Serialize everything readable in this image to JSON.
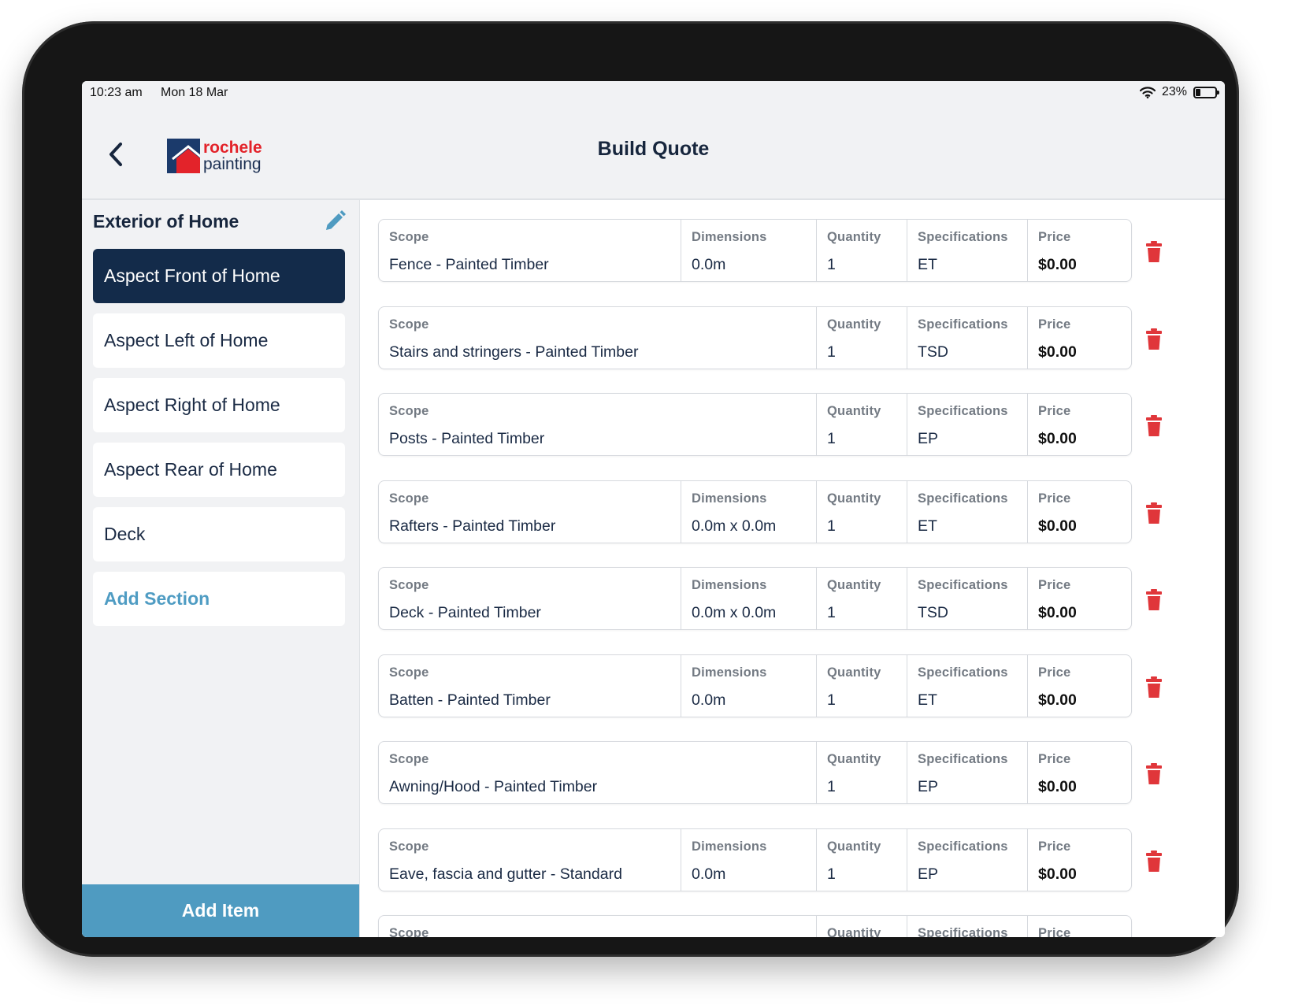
{
  "status": {
    "time": "10:23 am",
    "date": "Mon 18 Mar",
    "battery": "23%",
    "battery_level": 0.23
  },
  "header": {
    "title": "Build Quote",
    "logo_line1": "rochele",
    "logo_line2": "painting"
  },
  "sidebar": {
    "section_title": "Exterior of Home",
    "items": [
      {
        "label": "Aspect Front of Home"
      },
      {
        "label": "Aspect Left of Home"
      },
      {
        "label": "Aspect Right of Home"
      },
      {
        "label": "Aspect Rear of Home"
      },
      {
        "label": "Deck"
      }
    ],
    "add_section": "Add Section",
    "add_item": "Add Item"
  },
  "labels": {
    "scope": "Scope",
    "dimensions": "Dimensions",
    "quantity": "Quantity",
    "specifications": "Specifications",
    "price": "Price"
  },
  "items": [
    {
      "scope": "Fence - Painted Timber",
      "dimensions": "0.0m",
      "quantity": "1",
      "specifications": "ET",
      "price": "$0.00"
    },
    {
      "scope": "Stairs and stringers - Painted Timber",
      "quantity": "1",
      "specifications": "TSD",
      "price": "$0.00"
    },
    {
      "scope": "Posts - Painted Timber",
      "quantity": "1",
      "specifications": "EP",
      "price": "$0.00"
    },
    {
      "scope": "Rafters - Painted Timber",
      "dimensions": "0.0m x 0.0m",
      "quantity": "1",
      "specifications": "ET",
      "price": "$0.00"
    },
    {
      "scope": "Deck - Painted Timber",
      "dimensions": "0.0m x 0.0m",
      "quantity": "1",
      "specifications": "TSD",
      "price": "$0.00"
    },
    {
      "scope": "Batten - Painted Timber",
      "dimensions": "0.0m",
      "quantity": "1",
      "specifications": "ET",
      "price": "$0.00"
    },
    {
      "scope": "Awning/Hood - Painted Timber",
      "quantity": "1",
      "specifications": "EP",
      "price": "$0.00"
    },
    {
      "scope": "Eave, fascia and gutter - Standard",
      "dimensions": "0.0m",
      "quantity": "1",
      "specifications": "EP",
      "price": "$0.00"
    }
  ],
  "colors": {
    "navy": "#132b4a",
    "accent_blue": "#4f9bc1",
    "delete_red": "#e0363a"
  },
  "icons": {
    "back": "chevron-left-icon",
    "edit": "pencil-icon",
    "delete": "trash-icon",
    "wifi": "wifi-icon",
    "battery": "battery-icon"
  }
}
